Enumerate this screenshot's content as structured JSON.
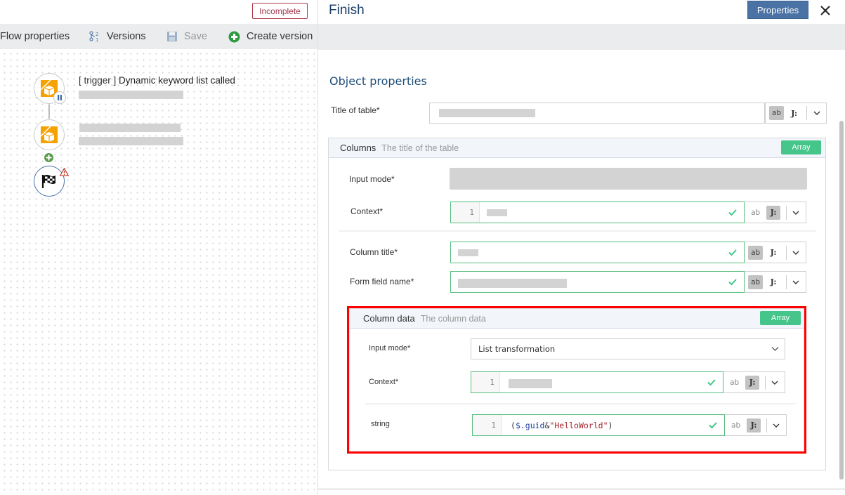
{
  "left_header": {
    "status_badge": "Incomplete"
  },
  "left_toolbar": {
    "items": [
      {
        "label": "Flow properties",
        "icon": "none"
      },
      {
        "label": "Versions",
        "icon": "versions-icon"
      },
      {
        "label": "Save",
        "icon": "save-icon",
        "disabled": true
      },
      {
        "label": "Create version",
        "icon": "plus-circle-icon"
      }
    ]
  },
  "flow": {
    "nodes": [
      {
        "type": "trigger",
        "tag": "[ trigger ]",
        "title": "Dynamic keyword list called",
        "icon": "box-icon",
        "badge": "pause-icon"
      },
      {
        "type": "action",
        "title": "",
        "icon": "box-icon"
      },
      {
        "type": "finish",
        "icon": "checkered-flag-icon",
        "badge": "warning-icon"
      }
    ],
    "add_step_icon": "plus-circle-icon"
  },
  "panel": {
    "title": "Finish",
    "properties_button": "Properties",
    "close_icon": "close-icon",
    "section_title": "Object properties",
    "title_of_table": {
      "label": "Title of table*",
      "mode": "ab"
    },
    "columns_group": {
      "name": "Columns",
      "description": "The title of the table",
      "badge": "Array",
      "input_mode": {
        "label": "Input mode*",
        "value": ""
      },
      "context": {
        "label": "Context*",
        "line_number": "1",
        "mode": "json"
      },
      "column_title": {
        "label": "Column title*",
        "mode": "ab"
      },
      "form_field_name": {
        "label": "Form field name*",
        "mode": "ab"
      }
    },
    "column_data_group": {
      "name": "Column data",
      "description": "The column data",
      "badge": "Array",
      "input_mode": {
        "label": "Input mode*",
        "value": "List transformation"
      },
      "context": {
        "label": "Context*",
        "line_number": "1",
        "mode": "json"
      },
      "string_field": {
        "label": "string",
        "line_number": "1",
        "code_open": "(",
        "code_var": "$.guid",
        "code_op": "&",
        "code_str": "\"HelloWorld\"",
        "code_close": ")",
        "mode": "json"
      }
    },
    "mode_labels": {
      "ab": "ab",
      "json": "J:"
    }
  },
  "colors": {
    "accent_blue": "#4a72a5",
    "title_blue": "#1c3f6b",
    "valid_green": "#55bd7c",
    "array_green": "#45c58a",
    "highlight_red": "#ff0000",
    "incomplete_red": "#b0384a",
    "node_orange": "#f5a100"
  }
}
